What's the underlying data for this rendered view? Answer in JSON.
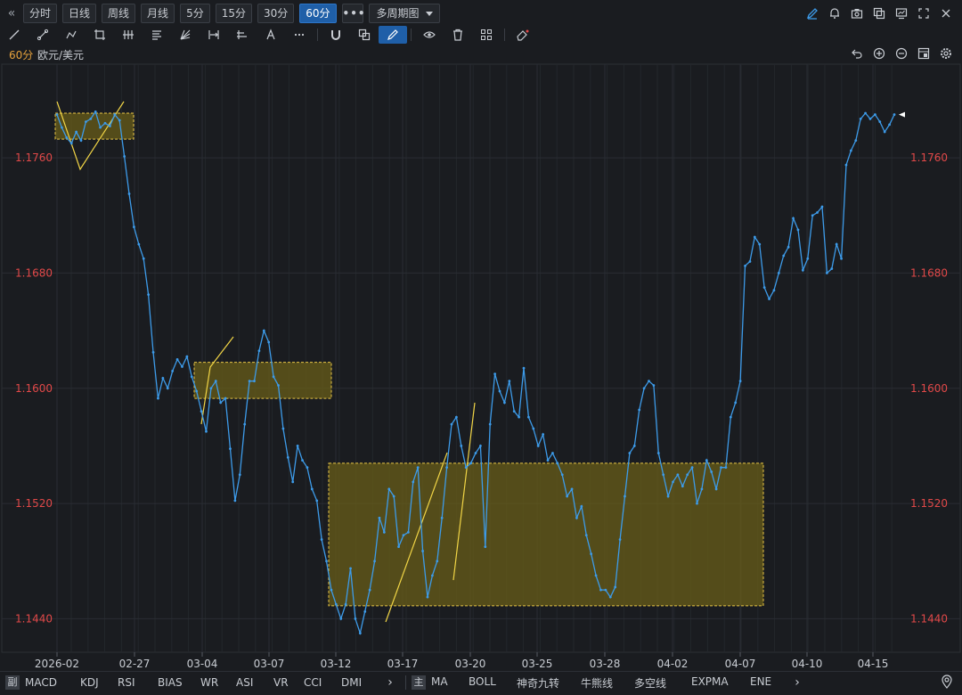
{
  "timeframes": [
    "分时",
    "日线",
    "周线",
    "月线",
    "5分",
    "15分",
    "30分",
    "60分"
  ],
  "active_timeframe": "60分",
  "more_label": "•••",
  "multi_period_label": "多周期图",
  "period_label": "60分",
  "symbol": "欧元/美元",
  "sub_tag": "副",
  "main_tag": "主",
  "sub_indicators": [
    "MACD",
    "KDJ",
    "RSI",
    "BIAS",
    "WR",
    "ASI",
    "VR",
    "CCI",
    "DMI"
  ],
  "main_indicators": [
    "MA",
    "BOLL",
    "神奇九转",
    "牛熊线",
    "多空线",
    "EXPMA",
    "ENE"
  ],
  "chart_data": {
    "type": "line",
    "x_tick_labels": [
      "2026-02",
      "02-27",
      "03-04",
      "03-07",
      "03-12",
      "03-17",
      "03-20",
      "03-25",
      "03-28",
      "04-02",
      "04-07",
      "04-10",
      "04-15"
    ],
    "y_tick_labels": [
      "1.1760",
      "1.1680",
      "1.1600",
      "1.1520",
      "1.1440"
    ],
    "ylim": [
      1.1418,
      1.1825
    ],
    "grid": true,
    "series": [
      {
        "values": [
          1.179,
          1.1781,
          1.1774,
          1.177,
          1.1778,
          1.1772,
          1.1785,
          1.1787,
          1.1792,
          1.1781,
          1.1784,
          1.1782,
          1.179,
          1.1786,
          1.1761,
          1.1735,
          1.1712,
          1.17,
          1.169,
          1.1665,
          1.1625,
          1.1593,
          1.1607,
          1.16,
          1.1612,
          1.162,
          1.1615,
          1.1622,
          1.1608,
          1.1598,
          1.1584,
          1.157,
          1.16,
          1.1605,
          1.159,
          1.1593,
          1.1558,
          1.1522,
          1.154,
          1.1575,
          1.1605,
          1.1605,
          1.1626,
          1.164,
          1.1632,
          1.1608,
          1.1602,
          1.1572,
          1.1552,
          1.1535,
          1.156,
          1.155,
          1.1545,
          1.153,
          1.1522,
          1.1495,
          1.148,
          1.146,
          1.145,
          1.144,
          1.145,
          1.1475,
          1.144,
          1.143,
          1.1445,
          1.146,
          1.148,
          1.151,
          1.15,
          1.153,
          1.1525,
          1.149,
          1.1498,
          1.15,
          1.1535,
          1.1545,
          1.1487,
          1.1455,
          1.147,
          1.148,
          1.151,
          1.1545,
          1.1575,
          1.158,
          1.156,
          1.1545,
          1.1548,
          1.1555,
          1.156,
          1.149,
          1.1575,
          1.161,
          1.1598,
          1.159,
          1.1605,
          1.1584,
          1.158,
          1.1614,
          1.158,
          1.1572,
          1.156,
          1.1568,
          1.155,
          1.1555,
          1.1548,
          1.154,
          1.1525,
          1.153,
          1.151,
          1.1518,
          1.1498,
          1.1485,
          1.147,
          1.146,
          1.146,
          1.1455,
          1.1462,
          1.1495,
          1.1525,
          1.1555,
          1.156,
          1.1585,
          1.16,
          1.1605,
          1.1602,
          1.1555,
          1.154,
          1.1525,
          1.1535,
          1.154,
          1.1532,
          1.154,
          1.1545,
          1.152,
          1.153,
          1.155,
          1.1542,
          1.153,
          1.1545,
          1.1545,
          1.158,
          1.159,
          1.1605,
          1.1685,
          1.1688,
          1.1705,
          1.17,
          1.167,
          1.1662,
          1.1668,
          1.168,
          1.1692,
          1.1698,
          1.1718,
          1.171,
          1.1682,
          1.169,
          1.172,
          1.1722,
          1.1726,
          1.168,
          1.1683,
          1.17,
          1.169,
          1.1755,
          1.1765,
          1.1772,
          1.1787,
          1.1791,
          1.1787,
          1.179,
          1.1785,
          1.1778,
          1.1783,
          1.179
        ]
      }
    ],
    "current_price_marker": true,
    "zones": [
      {
        "y_top": 1.1791,
        "y_bottom": 1.1773
      },
      {
        "y_top": 1.1618,
        "y_bottom": 1.1593
      },
      {
        "y_top": 1.1548,
        "y_bottom": 1.1449
      }
    ]
  },
  "colors": {
    "background": "#1a1c20",
    "line": "#3d9be9",
    "zone_fill": "#6b5f18",
    "zone_border": "#e8c547",
    "axis_label": "#e04848",
    "grid": "#2a2d33",
    "accent": "#1f5fa8"
  },
  "icons": {
    "top_right": [
      "pencil-icon",
      "bell-icon",
      "camera-icon",
      "copy-icon",
      "monitor-icon",
      "fullscreen-icon",
      "close-icon"
    ],
    "tools": [
      "line-tool-icon",
      "segment-tool-icon",
      "polyline-tool-icon",
      "crop-tool-icon",
      "fork-tool-icon",
      "fib-tool-icon",
      "fan-tool-icon",
      "range-tool-icon",
      "price-tool-icon",
      "text-tool-icon",
      "more-tools-icon",
      "magnet-icon",
      "layers-icon",
      "brush-icon",
      "eye-icon",
      "trash-icon",
      "widgets-icon",
      "eraser-icon"
    ],
    "chart_ctrl": [
      "undo-icon",
      "zoom-in-icon",
      "zoom-out-icon",
      "chart-settings-icon",
      "gear-icon"
    ]
  }
}
